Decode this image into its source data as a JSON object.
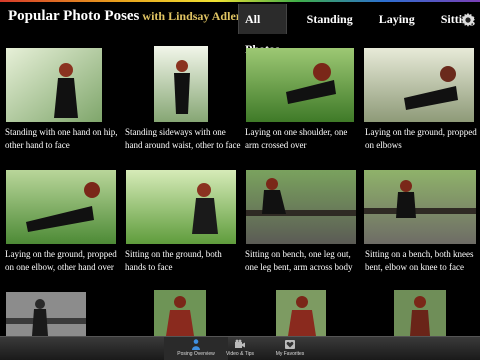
{
  "header": {
    "title": "Popular Photo Poses",
    "subtitle": "with Lindsay Adler",
    "tabs": [
      {
        "label": "All Photos",
        "active": true
      },
      {
        "label": "Standing",
        "active": false
      },
      {
        "label": "Laying",
        "active": false
      },
      {
        "label": "Sitting",
        "active": false
      }
    ],
    "settings_icon": "gear-icon"
  },
  "colors": {
    "background": "#000000",
    "subtitle": "#e0c463",
    "active_tab": "#2b2b2b",
    "active_bottom_icon": "#3f8fe0"
  },
  "photos": [
    {
      "caption": "Standing with one hand on hip, other hand to face"
    },
    {
      "caption": "Standing sideways with one hand around waist, other to face"
    },
    {
      "caption": "Laying on one shoulder, one arm crossed over"
    },
    {
      "caption": "Laying on the ground, propped on elbows"
    },
    {
      "caption": "Laying on the ground, propped on one elbow, other hand over"
    },
    {
      "caption": "Sitting on the ground, both hands to face"
    },
    {
      "caption": "Sitting on bench, one leg out, one leg bent, arm across body"
    },
    {
      "caption": "Sitting on a bench, both knees bent, elbow on knee to face"
    },
    {
      "caption": ""
    },
    {
      "caption": ""
    },
    {
      "caption": ""
    },
    {
      "caption": ""
    }
  ],
  "bottom_bar": {
    "items": [
      {
        "label": "Posing Overview",
        "icon": "person-icon",
        "active": true
      },
      {
        "label": "Video & Tips",
        "icon": "video-camera-icon",
        "active": false
      },
      {
        "label": "My Favorites",
        "icon": "heart-icon",
        "active": false
      }
    ]
  }
}
